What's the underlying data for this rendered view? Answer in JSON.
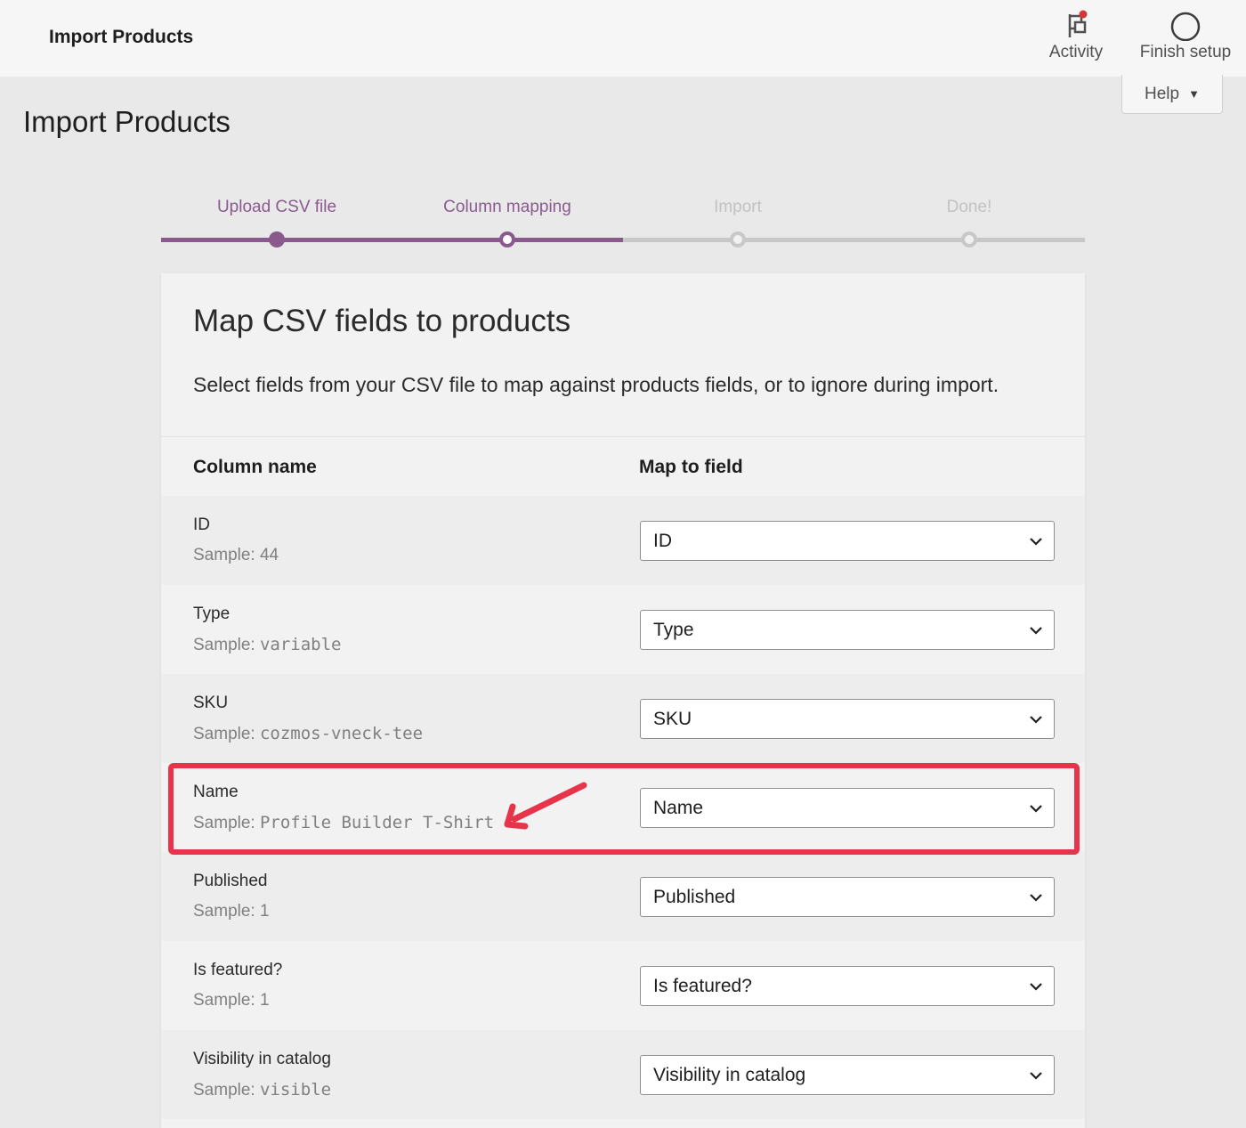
{
  "topbar": {
    "title": "Import Products",
    "activity_label": "Activity",
    "finish_setup_label": "Finish setup",
    "help_label": "Help"
  },
  "page": {
    "title": "Import Products"
  },
  "stepper": {
    "steps": [
      {
        "label": "Upload CSV file",
        "state": "done"
      },
      {
        "label": "Column mapping",
        "state": "current"
      },
      {
        "label": "Import",
        "state": "pending"
      },
      {
        "label": "Done!",
        "state": "pending"
      }
    ]
  },
  "card": {
    "title": "Map CSV fields to products",
    "description": "Select fields from your CSV file to map against products fields, or to ignore during import.",
    "col_name_header": "Column name",
    "col_map_header": "Map to field",
    "sample_prefix": "Sample:",
    "rows": [
      {
        "name": "ID",
        "sample": "44",
        "sample_mono": false,
        "mapped": "ID"
      },
      {
        "name": "Type",
        "sample": "variable",
        "sample_mono": true,
        "mapped": "Type"
      },
      {
        "name": "SKU",
        "sample": "cozmos-vneck-tee",
        "sample_mono": true,
        "mapped": "SKU"
      },
      {
        "name": "Name",
        "sample": "Profile Builder T-Shirt",
        "sample_mono": true,
        "mapped": "Name"
      },
      {
        "name": "Published",
        "sample": "1",
        "sample_mono": false,
        "mapped": "Published"
      },
      {
        "name": "Is featured?",
        "sample": "1",
        "sample_mono": false,
        "mapped": "Is featured?"
      },
      {
        "name": "Visibility in catalog",
        "sample": "visible",
        "sample_mono": true,
        "mapped": "Visibility in catalog"
      }
    ]
  },
  "colors": {
    "accent": "#8a5a8f",
    "annotation": "#e8344a",
    "pending": "#c8c8c8"
  },
  "icons": {
    "activity": "flag-icon",
    "finish_setup": "circle-icon",
    "help_caret": "caret-down-icon",
    "select_chevron": "chevron-down-icon",
    "annotation": "red-arrow-icon"
  }
}
